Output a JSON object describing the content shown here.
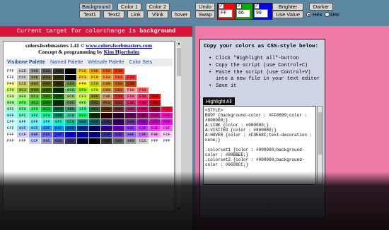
{
  "toolbar": {
    "target_buttons": [
      "Background",
      "Color 1",
      "Color 2",
      "Undo",
      "Brighter",
      "Darker"
    ],
    "element_buttons": [
      "Text1",
      "Text2",
      "Link",
      "Vlink",
      "hover",
      "Swap",
      "Use Value"
    ],
    "rgb_values": [
      "FF",
      "66",
      "99"
    ],
    "channel_colors": [
      "#ff0000",
      "#00aa00",
      "#0000ff"
    ],
    "radio_labels": [
      "Hex",
      "Dec"
    ],
    "selected_radio": "Hex"
  },
  "left": {
    "target_prefix": "Current target for colorchange is ",
    "target_name": "background",
    "palette_title_text": "colors4webmasters 1.41 © ",
    "palette_title_link": "www.colors4webmasters.com",
    "palette_credit_text": "Concept & programming by ",
    "palette_credit_link": "Kim Hjortholm",
    "tabs": [
      "Visibone Palette",
      "Named Palette",
      "Websafe Palette",
      "Color Sets"
    ],
    "active_tab": "Visibone Palette"
  },
  "right": {
    "heading": "Copy your colors as CSS-style below:",
    "steps": [
      "Click \"Highlight all\"-button",
      "Copy the script (use Control+C)",
      "Paste the script (use Control+V) into a new file in your text editor",
      "Save it"
    ],
    "highlight_label": "Highlight All",
    "css_code": "<STYLE>\nBODY {background-color : #FF6699;color : #000000;}\nA:LINK {color : #000080;}\nA:VISITED {color : #800080;}\nA:HOVER {color : #FOE68C;text-decoration : none;}\n\n.colorset1 {color : #000000;background-color : #88BBEE;}\n.colorset2 {color : #000000;background-color : #6699CC;}"
  },
  "colors": {
    "page_bg": "#5b87a2",
    "target_banner": "#dc143c",
    "right_panel_bg": "#f07aa6",
    "instructions_bg": "#cfd5e7",
    "swatch_rows": [
      [
        "#ffffff",
        "#cccccc",
        "#999999",
        "#666666",
        "#333333",
        "#000000",
        "#ffcc00",
        "#ff9900",
        "#ff6600",
        "#ff3300",
        "#ffffff",
        "#ffffff",
        "#ffffff",
        "#ffffff"
      ],
      [
        "#ffffff",
        "#cccccc",
        "#999966",
        "#666633",
        "#333300",
        "#000000",
        "#ffcc33",
        "#ffcc00",
        "#ff9933",
        "#ff6633",
        "#ff3333",
        "#ffffff",
        "#ffffff",
        "#ffffff"
      ],
      [
        "#ffff99",
        "#cccc66",
        "#999933",
        "#666600",
        "#333300",
        "#669933",
        "#ffff00",
        "#cccc00",
        "#cc9900",
        "#cc6600",
        "#cc3300",
        "#ffffff",
        "#ffffff",
        "#ffffff"
      ],
      [
        "#ccff66",
        "#99cc33",
        "#669900",
        "#336600",
        "#003300",
        "#66cc66",
        "#99ff00",
        "#ccff00",
        "#cc9933",
        "#cc6633",
        "#ff9999",
        "#ff6666",
        "#ffffff",
        "#ffffff"
      ],
      [
        "#ccff99",
        "#99ff66",
        "#66cc33",
        "#339900",
        "#006600",
        "#99cc66",
        "#ccff33",
        "#999900",
        "#cc9966",
        "#cc3333",
        "#ff6699",
        "#ff3366",
        "#ff0000",
        "#ffffff"
      ],
      [
        "#99ff99",
        "#66ff66",
        "#33cc33",
        "#009900",
        "#003300",
        "#669966",
        "#99ff66",
        "#666633",
        "#996633",
        "#993333",
        "#cc3366",
        "#ff0066",
        "#cc0000",
        "#ffffff"
      ],
      [
        "#99ffcc",
        "#66ff99",
        "#33ff66",
        "#00cc33",
        "#006633",
        "#339966",
        "#33ff99",
        "#336633",
        "#663300",
        "#663333",
        "#993366",
        "#cc0066",
        "#990033",
        "#ff0033"
      ],
      [
        "#99ffff",
        "#66ffcc",
        "#33ffcc",
        "#00ff99",
        "#009966",
        "#33cc99",
        "#00ff66",
        "#003300",
        "#330000",
        "#330033",
        "#660066",
        "#990066",
        "#cc0099",
        "#ff00cc"
      ],
      [
        "#ccffff",
        "#99ffff",
        "#66ffff",
        "#33ffff",
        "#00ffcc",
        "#00cc99",
        "#009999",
        "#006666",
        "#333366",
        "#330066",
        "#663399",
        "#9900cc",
        "#cc00cc",
        "#ff00ff"
      ],
      [
        "#ccffff",
        "#99ccff",
        "#66ccff",
        "#3399ff",
        "#0099ff",
        "#0066cc",
        "#003399",
        "#000066",
        "#330099",
        "#6600cc",
        "#9933ff",
        "#cc33ff",
        "#ff33ff",
        "#ff66ff"
      ],
      [
        "#ffffff",
        "#ccccff",
        "#9999ff",
        "#6666ff",
        "#3333ff",
        "#0000ff",
        "#0000cc",
        "#000099",
        "#333399",
        "#6633cc",
        "#9966ff",
        "#cc66ff",
        "#ff99ff",
        "#ffccff"
      ],
      [
        "#ffffff",
        "#ffffff",
        "#ccccff",
        "#9999cc",
        "#666699",
        "#333366",
        "#000033",
        "#000000",
        "#333333",
        "#666666",
        "#999999",
        "#cccccc",
        "#ffffff",
        "#ffffff"
      ]
    ],
    "swatch_labels": [
      [
        "FFF",
        "CCC",
        "999",
        "666",
        "333",
        "000",
        "FC0",
        "F90",
        "F60",
        "F30",
        "",
        "",
        "",
        ""
      ],
      [
        "FFF",
        "CCC",
        "996",
        "663",
        "330",
        "000",
        "FC3",
        "FC0",
        "F93",
        "F63",
        "F33",
        "",
        "",
        ""
      ],
      [
        "FF9",
        "CC6",
        "993",
        "660",
        "330",
        "693",
        "FF0",
        "CC0",
        "C90",
        "C60",
        "C30",
        "",
        "",
        ""
      ],
      [
        "CF6",
        "9C3",
        "690",
        "360",
        "030",
        "6C6",
        "9F0",
        "CF0",
        "C93",
        "C63",
        "F99",
        "F66",
        "",
        ""
      ],
      [
        "CF9",
        "9F6",
        "6C3",
        "390",
        "060",
        "9C6",
        "CF3",
        "990",
        "C96",
        "C33",
        "F69",
        "F36",
        "F00",
        ""
      ],
      [
        "9F9",
        "6F6",
        "3C3",
        "090",
        "030",
        "696",
        "9F6",
        "663",
        "963",
        "933",
        "C36",
        "F06",
        "C00",
        ""
      ],
      [
        "9FC",
        "6F9",
        "3F6",
        "0C3",
        "063",
        "396",
        "3F9",
        "363",
        "630",
        "633",
        "936",
        "C06",
        "903",
        "F03"
      ],
      [
        "9FF",
        "6FC",
        "3FC",
        "0F9",
        "096",
        "3C9",
        "0F6",
        "030",
        "300",
        "303",
        "606",
        "906",
        "C09",
        "F0C"
      ],
      [
        "CFF",
        "9FF",
        "6FF",
        "3FF",
        "0FC",
        "0C9",
        "099",
        "066",
        "336",
        "306",
        "639",
        "90C",
        "C0C",
        "F0F"
      ],
      [
        "CFF",
        "9CF",
        "6CF",
        "39F",
        "09F",
        "06C",
        "039",
        "006",
        "309",
        "60C",
        "93F",
        "C3F",
        "F3F",
        "F6F"
      ],
      [
        "FFF",
        "CCF",
        "99F",
        "66F",
        "33F",
        "00F",
        "00C",
        "009",
        "339",
        "63C",
        "96F",
        "C6F",
        "F9F",
        "FCF"
      ],
      [
        "FFF",
        "FFF",
        "CCF",
        "99C",
        "669",
        "336",
        "003",
        "000",
        "333",
        "666",
        "999",
        "CCC",
        "FFF",
        "FFF"
      ]
    ]
  }
}
